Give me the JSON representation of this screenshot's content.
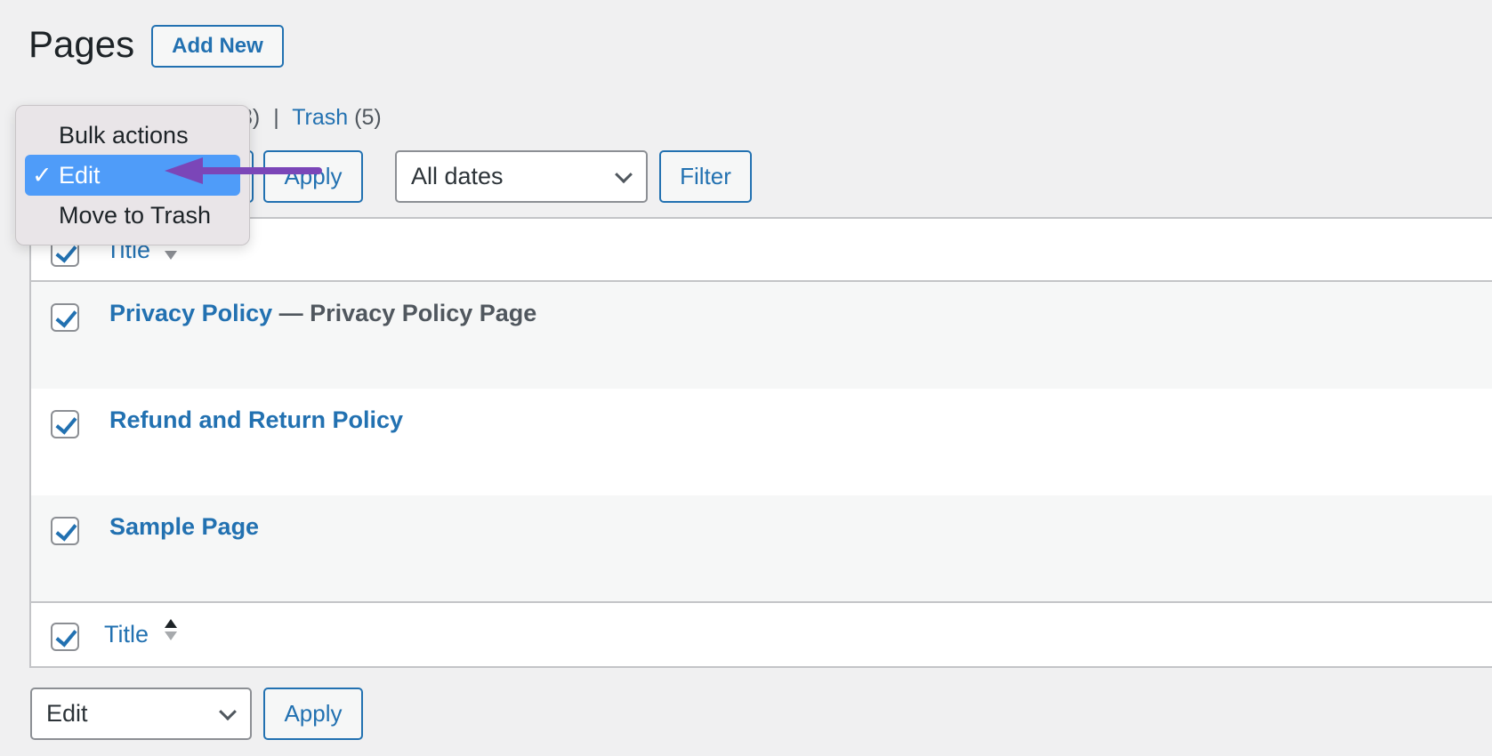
{
  "header": {
    "title": "Pages",
    "add_new": "Add New"
  },
  "views": {
    "partial_count": "3)",
    "sep": "|",
    "trash_label": "Trash",
    "trash_count": "(5)"
  },
  "bulk_menu": {
    "items": [
      {
        "label": "Bulk actions"
      },
      {
        "label": "Edit",
        "selected": true,
        "check": "✓"
      },
      {
        "label": "Move to Trash"
      }
    ]
  },
  "toolbar": {
    "apply": "Apply",
    "dates": "All dates",
    "filter": "Filter"
  },
  "table": {
    "column": "Title",
    "rows": [
      {
        "title": "Privacy Policy",
        "state": "— Privacy Policy Page",
        "checked": true
      },
      {
        "title": "Refund and Return Policy",
        "state": "",
        "checked": true
      },
      {
        "title": "Sample Page",
        "state": "",
        "checked": true
      }
    ]
  },
  "bottom": {
    "bulk_value": "Edit",
    "apply": "Apply"
  },
  "colors": {
    "accent": "#2271b1",
    "highlight": "#4f9cf9",
    "annotation_arrow": "#7b46b8"
  }
}
